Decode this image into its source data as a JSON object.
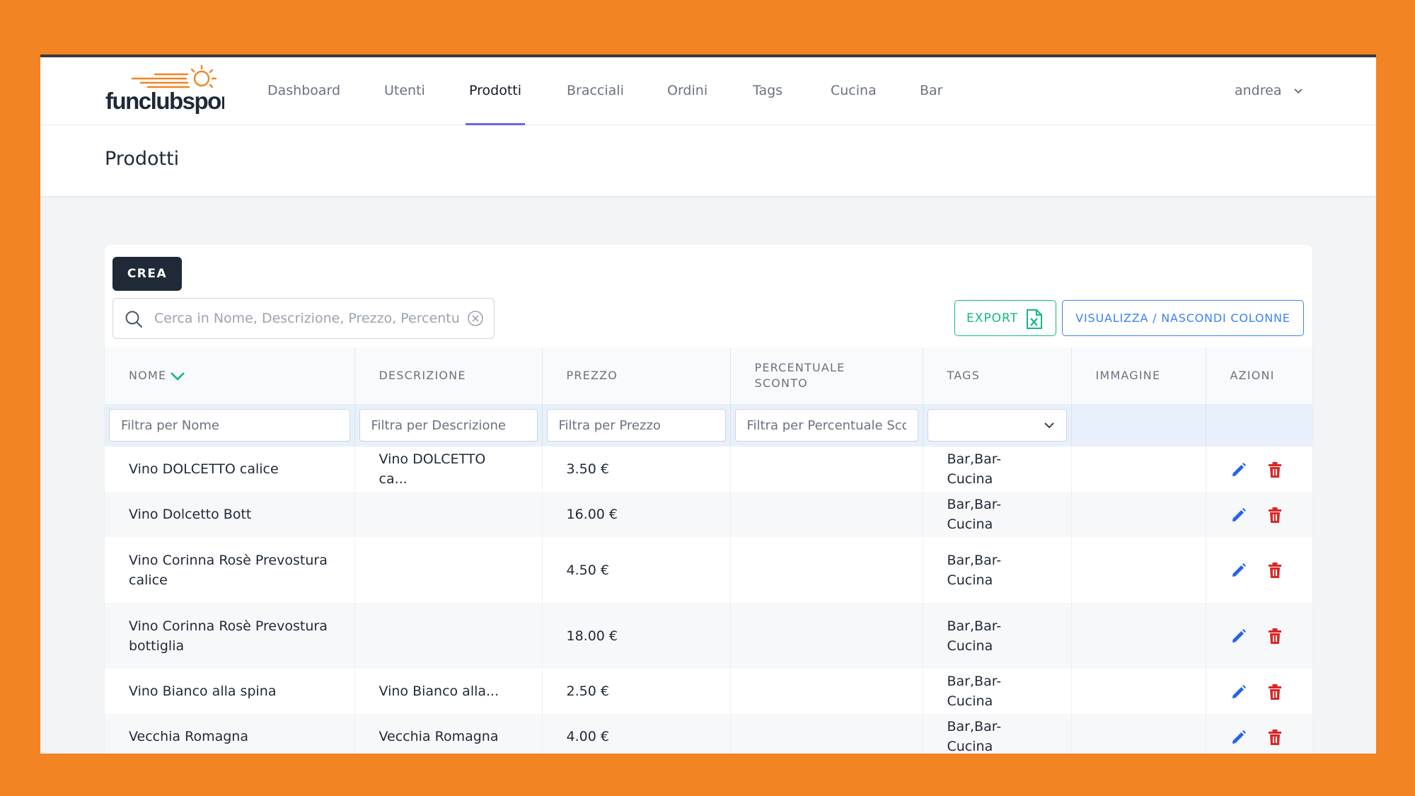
{
  "nav": {
    "logo_text": "funclubsport",
    "items": [
      {
        "label": "Dashboard"
      },
      {
        "label": "Utenti"
      },
      {
        "label": "Prodotti"
      },
      {
        "label": "Bracciali"
      },
      {
        "label": "Ordini"
      },
      {
        "label": "Tags"
      },
      {
        "label": "Cucina"
      },
      {
        "label": "Bar"
      }
    ],
    "active": "Prodotti",
    "user": "andrea"
  },
  "page": {
    "title": "Prodotti"
  },
  "toolbar": {
    "create_label": "CREA",
    "search_placeholder": "Cerca in Nome, Descrizione, Prezzo, Percentuale Sconto",
    "export_label": "EXPORT",
    "columns_label": "VISUALIZZA / NASCONDI COLONNE"
  },
  "table": {
    "headers": [
      "NOME",
      "DESCRIZIONE",
      "PREZZO",
      "PERCENTUALE SCONTO",
      "TAGS",
      "IMMAGINE",
      "AZIONI"
    ],
    "sort_column": "NOME",
    "filters": {
      "nome": "Filtra per Nome",
      "descrizione": "Filtra per Descrizione",
      "prezzo": "Filtra per Prezzo",
      "sconto": "Filtra per Percentuale Sconto",
      "tags_selected": ""
    },
    "rows": [
      {
        "nome": "Vino DOLCETTO calice",
        "descrizione": "Vino DOLCETTO ca...",
        "prezzo": "3.50 €",
        "sconto": "",
        "tags": "Bar,Bar-Cucina"
      },
      {
        "nome": "Vino Dolcetto Bott",
        "descrizione": "",
        "prezzo": "16.00 €",
        "sconto": "",
        "tags": "Bar,Bar-Cucina"
      },
      {
        "nome": "Vino Corinna Rosè Prevostura calice",
        "descrizione": "",
        "prezzo": "4.50 €",
        "sconto": "",
        "tags": "Bar,Bar-Cucina"
      },
      {
        "nome": "Vino Corinna Rosè Prevostura bottiglia",
        "descrizione": "",
        "prezzo": "18.00 €",
        "sconto": "",
        "tags": "Bar,Bar-Cucina"
      },
      {
        "nome": "Vino Bianco alla spina",
        "descrizione": "Vino Bianco alla...",
        "prezzo": "2.50 €",
        "sconto": "",
        "tags": "Bar,Bar-Cucina"
      },
      {
        "nome": "Vecchia Romagna",
        "descrizione": "Vecchia Romagna",
        "prezzo": "4.00 €",
        "sconto": "",
        "tags": "Bar,Bar-Cucina"
      }
    ]
  },
  "icons": {
    "search": "search-icon",
    "clear": "clear-icon",
    "excel": "excel-file-icon",
    "sort": "chevron-down-icon",
    "edit": "pencil-icon",
    "delete": "trash-icon",
    "select": "chevron-down-icon",
    "user_menu": "chevron-down-icon"
  },
  "colors": {
    "background": "#F28424",
    "brand_orange": "#F28424",
    "nav_active_underline": "#6366F1",
    "primary_dark": "#1F2937",
    "export_green": "#10B981",
    "columns_blue": "#3B82F6",
    "edit_blue": "#2563EB",
    "delete_red": "#DC2626",
    "filter_row": "#E7F0FB"
  }
}
